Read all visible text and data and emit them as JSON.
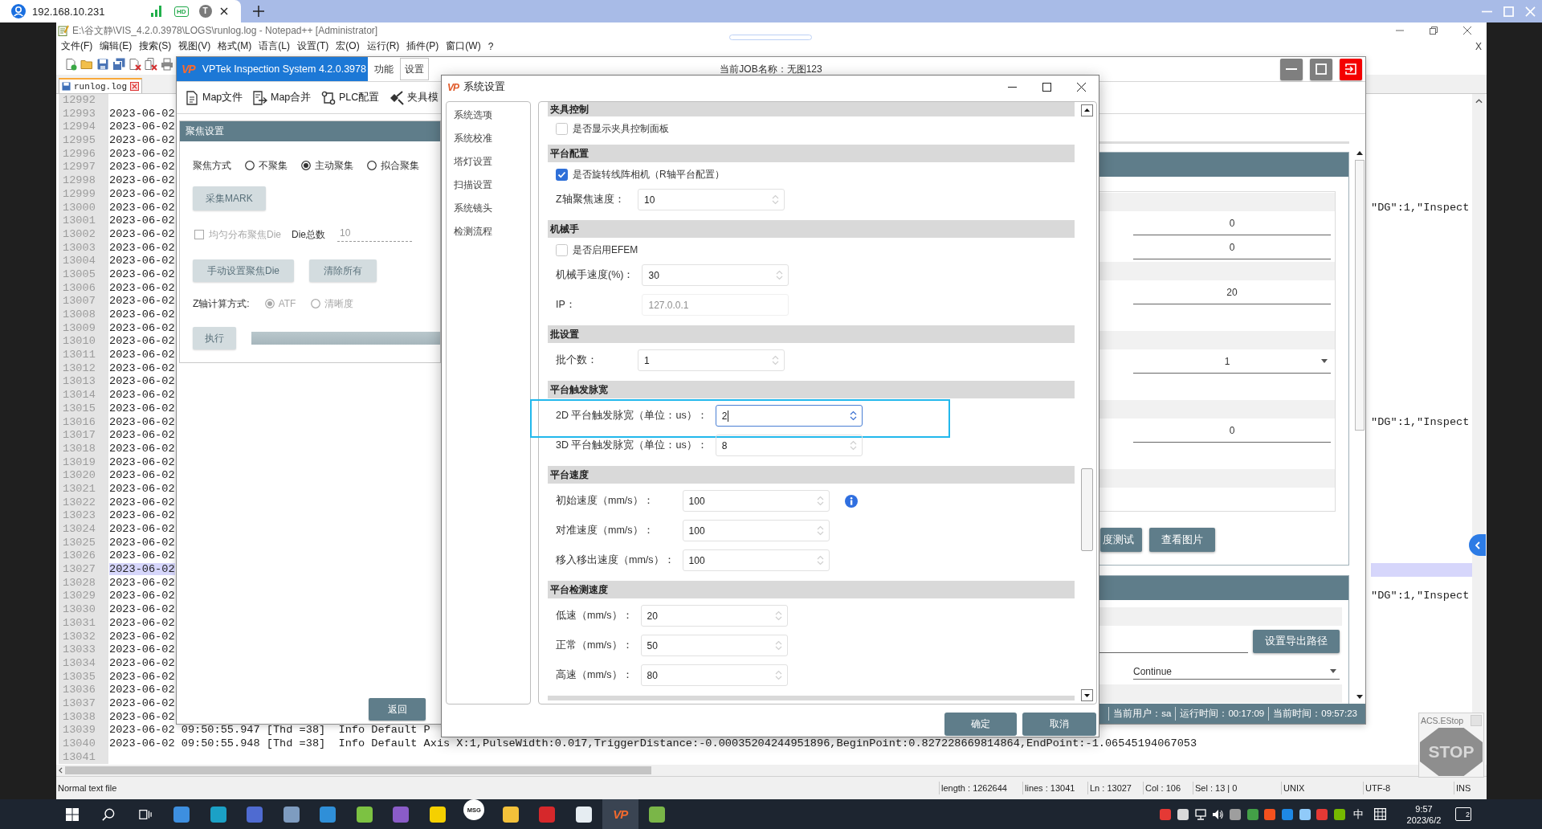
{
  "remote": {
    "address": "192.168.10.231",
    "quality": "HD",
    "user_initial": "T"
  },
  "notepad": {
    "title": "E:\\谷文静\\VIS_4.2.0.3978\\LOGS\\runlog.log - Notepad++ [Administrator]",
    "menu": [
      "文件(F)",
      "编辑(E)",
      "搜索(S)",
      "视图(V)",
      "格式(M)",
      "语言(L)",
      "设置(T)",
      "宏(O)",
      "运行(R)",
      "插件(P)",
      "窗口(W)",
      "?"
    ],
    "close_doc": "X",
    "tab": {
      "label": "runlog.log",
      "selected": true
    },
    "lines": [
      {
        "number": "12992",
        "current": false
      },
      {
        "number": "12993",
        "text": "2023-06-02",
        "current": false
      },
      {
        "number": "12994",
        "text": "2023-06-02",
        "current": false
      },
      {
        "number": "12995",
        "text": "2023-06-02",
        "current": false
      },
      {
        "number": "12996",
        "text": "2023-06-02",
        "current": false
      },
      {
        "number": "12997",
        "text": "2023-06-02",
        "current": false
      },
      {
        "number": "12998",
        "text": "2023-06-02",
        "current": false
      },
      {
        "number": "12999",
        "text": "2023-06-02",
        "current": false
      },
      {
        "number": "13000",
        "text": "2023-06-02",
        "tail": "\"DG\":1,\"Inspect",
        "current": false
      },
      {
        "number": "13001",
        "text": "2023-06-02",
        "current": false
      },
      {
        "number": "13002",
        "text": "2023-06-02",
        "current": false
      },
      {
        "number": "13003",
        "text": "2023-06-02",
        "current": false
      },
      {
        "number": "13004",
        "text": "2023-06-02",
        "current": false
      },
      {
        "number": "13005",
        "text": "2023-06-02",
        "current": false
      },
      {
        "number": "13006",
        "text": "2023-06-02",
        "current": false
      },
      {
        "number": "13007",
        "text": "2023-06-02",
        "current": false
      },
      {
        "number": "13008",
        "text": "2023-06-02",
        "current": false
      },
      {
        "number": "13009",
        "text": "2023-06-02",
        "current": false
      },
      {
        "number": "13010",
        "text": "2023-06-02",
        "current": false
      },
      {
        "number": "13011",
        "text": "2023-06-02",
        "current": false
      },
      {
        "number": "13012",
        "text": "2023-06-02",
        "current": false
      },
      {
        "number": "13013",
        "text": "2023-06-02",
        "current": false
      },
      {
        "number": "13014",
        "text": "2023-06-02",
        "current": false
      },
      {
        "number": "13015",
        "text": "2023-06-02",
        "current": false
      },
      {
        "number": "13016",
        "text": "2023-06-02",
        "tail": "\"DG\":1,\"Inspect",
        "current": false
      },
      {
        "number": "13017",
        "text": "2023-06-02",
        "current": false
      },
      {
        "number": "13018",
        "text": "2023-06-02",
        "current": false
      },
      {
        "number": "13019",
        "text": "2023-06-02",
        "current": false
      },
      {
        "number": "13020",
        "text": "2023-06-02",
        "current": false
      },
      {
        "number": "13021",
        "text": "2023-06-02",
        "current": false
      },
      {
        "number": "13022",
        "text": "2023-06-02",
        "current": false
      },
      {
        "number": "13023",
        "text": "2023-06-02",
        "current": false
      },
      {
        "number": "13024",
        "text": "2023-06-02",
        "current": false
      },
      {
        "number": "13025",
        "text": "2023-06-02",
        "current": false
      },
      {
        "number": "13026",
        "text": "2023-06-02",
        "current": false
      },
      {
        "number": "13027",
        "text": "2023-06-02",
        "current": true
      },
      {
        "number": "13028",
        "text": "2023-06-02",
        "current": false
      },
      {
        "number": "13029",
        "text": "2023-06-02",
        "tail": "\"DG\":1,\"Inspect",
        "current": false
      },
      {
        "number": "13030",
        "text": "2023-06-02",
        "current": false
      },
      {
        "number": "13031",
        "text": "2023-06-02",
        "current": false
      },
      {
        "number": "13032",
        "text": "2023-06-02",
        "current": false
      },
      {
        "number": "13033",
        "text": "2023-06-02",
        "current": false
      },
      {
        "number": "13034",
        "text": "2023-06-02",
        "current": false
      },
      {
        "number": "13035",
        "text": "2023-06-02",
        "current": false
      },
      {
        "number": "13036",
        "text": "2023-06-02",
        "current": false
      },
      {
        "number": "13037",
        "text": "2023-06-02",
        "current": false
      },
      {
        "number": "13038",
        "text": "2023-06-02",
        "current": false
      },
      {
        "number": "13039",
        "text": "2023-06-02 09:50:55.947 [Thd =38]  Info Default P",
        "current": false
      },
      {
        "number": "13040",
        "text": "2023-06-02 09:50:55.948 [Thd =38]  Info Default Axis X:1,PulseWidth:0.017,TriggerDistance:-0.00035204244951896,BeginPoint:0.827228669814864,EndPoint:-1.06545194067053",
        "current": false
      },
      {
        "number": "13041",
        "current": false
      }
    ],
    "status": [
      "Normal text file",
      "length : 1262644",
      "lines : 13041",
      "Ln : 13027",
      "Col : 106",
      "Sel : 13 | 0",
      "UNIX",
      "UTF-8",
      "INS"
    ]
  },
  "vptek": {
    "logo": "VP",
    "title": "VPTek Inspection System 4.2.0.3978",
    "tabs": [
      {
        "label": "功能",
        "selected": false
      },
      {
        "label": "设置",
        "selected": true
      }
    ],
    "job": "当前JOB名称：无图123",
    "toolbar": [
      {
        "kind": "document",
        "label": "Map文件"
      },
      {
        "kind": "merge",
        "label": "Map合并"
      },
      {
        "kind": "plc",
        "label": "PLC配置"
      },
      {
        "kind": "fixture",
        "label": "夹具模"
      }
    ],
    "focus": {
      "title": "聚焦设置",
      "mode_label": "聚焦方式",
      "modes": [
        {
          "label": "不聚集",
          "selected": false
        },
        {
          "label": "主动聚集",
          "selected": true
        },
        {
          "label": "拟合聚集",
          "selected": false
        }
      ],
      "collect_button": {
        "label": "采集MARK",
        "disabled": true
      },
      "even": {
        "label": "均匀分布聚焦Die",
        "checked": false,
        "disabled": true
      },
      "die_label": "Die总数",
      "die_value": "10",
      "actions": [
        {
          "label": "手动设置聚焦Die",
          "disabled": true
        },
        {
          "label": "清除所有",
          "disabled": true
        }
      ],
      "z_label": "Z轴计算方式:",
      "z_modes": [
        {
          "label": "ATF",
          "selected": true,
          "disabled": true
        },
        {
          "label": "清晰度",
          "selected": false,
          "disabled": true
        }
      ],
      "run_button": {
        "label": "执行",
        "disabled": true
      },
      "progress": {
        "level": 1
      }
    },
    "back_button": {
      "label": "返回",
      "disabled": false
    },
    "detail": {
      "groups": [
        {
          "fields": [
            {
              "kind": "input",
              "value": "0"
            },
            {
              "kind": "input",
              "value": "0"
            }
          ]
        },
        {
          "fields": [
            {
              "kind": "input",
              "value": "20"
            }
          ]
        },
        {
          "fields": [
            {
              "kind": "select",
              "value": "1"
            }
          ]
        },
        {
          "fields": [
            {
              "kind": "input",
              "value": "0"
            }
          ]
        }
      ],
      "buttons": [
        {
          "label": "度测试"
        },
        {
          "label": "查看图片"
        }
      ]
    },
    "export": {
      "button": "设置导出路径",
      "mode": "Continue"
    },
    "status": [
      "当前用户：sa",
      "运行时间：00:17:09",
      "当前时间：09:57:23"
    ]
  },
  "dialog": {
    "logo": "VP",
    "title": "系统设置",
    "nav": [
      {
        "label": "系统选项",
        "selected": false
      },
      {
        "label": "系统校准",
        "selected": false
      },
      {
        "label": "塔灯设置",
        "selected": false
      },
      {
        "label": "扫描设置",
        "selected": false
      },
      {
        "label": "系统镜头",
        "selected": false
      },
      {
        "label": "检测流程",
        "selected": false
      }
    ],
    "sections": [
      {
        "title": "夹具控制",
        "rows": [
          {
            "kind": "check",
            "label": "是否显示夹具控制面板",
            "checked": false
          }
        ]
      },
      {
        "title": "平台配置",
        "rows": [
          {
            "kind": "check",
            "label": "是否旋转线阵相机（R轴平台配置）",
            "checked": true
          },
          {
            "kind": "spin",
            "label": "Z轴聚焦速度：",
            "value": "10",
            "disabled": false,
            "focused": false,
            "highlighted": false,
            "info": false
          }
        ]
      },
      {
        "title": "机械手",
        "rows": [
          {
            "kind": "check",
            "label": "是否启用EFEM",
            "checked": false
          },
          {
            "kind": "spin",
            "label": "机械手速度(%)：",
            "value": "30",
            "disabled": false,
            "focused": false,
            "highlighted": false,
            "info": false
          },
          {
            "kind": "text",
            "label": "IP：",
            "value": "127.0.0.1",
            "disabled": true,
            "focused": false,
            "highlighted": false,
            "info": false
          }
        ]
      },
      {
        "title": "批设置",
        "rows": [
          {
            "kind": "spin",
            "label": "批个数：",
            "value": "1",
            "disabled": false,
            "focused": false,
            "highlighted": false,
            "info": false
          }
        ]
      },
      {
        "title": "平台触发脉宽",
        "rows": [
          {
            "kind": "spin",
            "label": "2D 平台触发脉宽（单位：us）：",
            "value": "2",
            "disabled": false,
            "focused": true,
            "highlighted": true,
            "info": false
          },
          {
            "kind": "spin",
            "label": "3D 平台触发脉宽（单位：us）：",
            "value": "8",
            "disabled": false,
            "focused": false,
            "highlighted": false,
            "info": false
          }
        ]
      },
      {
        "title": "平台速度",
        "rows": [
          {
            "kind": "spin",
            "label": "初始速度（mm/s）：",
            "value": "100",
            "disabled": false,
            "focused": false,
            "highlighted": false,
            "info": true
          },
          {
            "kind": "spin",
            "label": "对准速度（mm/s）：",
            "value": "100",
            "disabled": false,
            "focused": false,
            "highlighted": false,
            "info": false
          },
          {
            "kind": "spin",
            "label": "移入移出速度（mm/s）：",
            "value": "100",
            "disabled": false,
            "focused": false,
            "highlighted": false,
            "info": false
          }
        ]
      },
      {
        "title": "平台检测速度",
        "rows": [
          {
            "kind": "spin",
            "label": "低速（mm/s）：",
            "value": "20",
            "disabled": false,
            "focused": false,
            "highlighted": false,
            "info": false
          },
          {
            "kind": "spin",
            "label": "正常（mm/s）：",
            "value": "50",
            "disabled": false,
            "focused": false,
            "highlighted": false,
            "info": false
          },
          {
            "kind": "spin",
            "label": "高速（mm/s）：",
            "value": "80",
            "disabled": false,
            "focused": false,
            "highlighted": false,
            "info": false
          }
        ]
      }
    ],
    "buttons": [
      "确定",
      "取消"
    ]
  },
  "estop": {
    "title": "ACS.EStop",
    "sign": "STOP"
  },
  "taskbar": {
    "apps": [
      {
        "kind": "windows",
        "selected": false
      },
      {
        "kind": "search",
        "selected": false
      },
      {
        "kind": "taskview",
        "selected": false
      },
      {
        "kind": "tile",
        "color": "#3d8fe0",
        "selected": false
      },
      {
        "kind": "tile",
        "color": "#1ba1c6",
        "selected": false
      },
      {
        "kind": "tile",
        "color": "#4f6bd1",
        "selected": false
      },
      {
        "kind": "tile",
        "color": "#7e9cc0",
        "selected": false
      },
      {
        "kind": "tile",
        "color": "#2f8fd8",
        "selected": false
      },
      {
        "kind": "tile",
        "color": "#7cc242",
        "selected": false
      },
      {
        "kind": "tile",
        "color": "#8a5cc8",
        "selected": false
      },
      {
        "kind": "tile",
        "color": "#f5d000",
        "selected": false
      },
      {
        "kind": "badge",
        "label": "MSG",
        "color": "#ffffff",
        "selected": false
      },
      {
        "kind": "tile",
        "color": "#f3c13a",
        "selected": false
      },
      {
        "kind": "tile",
        "color": "#d6282b",
        "selected": false
      },
      {
        "kind": "tile",
        "color": "#e6edf2",
        "selected": false
      },
      {
        "kind": "label",
        "label": "VP",
        "color": "#f26a2e",
        "selected": true
      },
      {
        "kind": "tile",
        "color": "#7ab648",
        "selected": false
      }
    ],
    "tray": [
      {
        "kind": "tile",
        "color": "#e53935"
      },
      {
        "kind": "tile",
        "color": "#d9d9d9"
      },
      {
        "kind": "network"
      },
      {
        "kind": "speaker"
      },
      {
        "kind": "tile",
        "color": "#9e9e9e"
      },
      {
        "kind": "tile",
        "color": "#43a047"
      },
      {
        "kind": "tile",
        "color": "#f4511e"
      },
      {
        "kind": "tile",
        "color": "#1e88e5"
      },
      {
        "kind": "tile",
        "color": "#90caf9"
      },
      {
        "kind": "tile",
        "color": "#e53935"
      },
      {
        "kind": "tile",
        "color": "#76b900"
      }
    ],
    "ime": "中",
    "time": "9:57",
    "date": "2023/6/2",
    "notifications": "2"
  }
}
